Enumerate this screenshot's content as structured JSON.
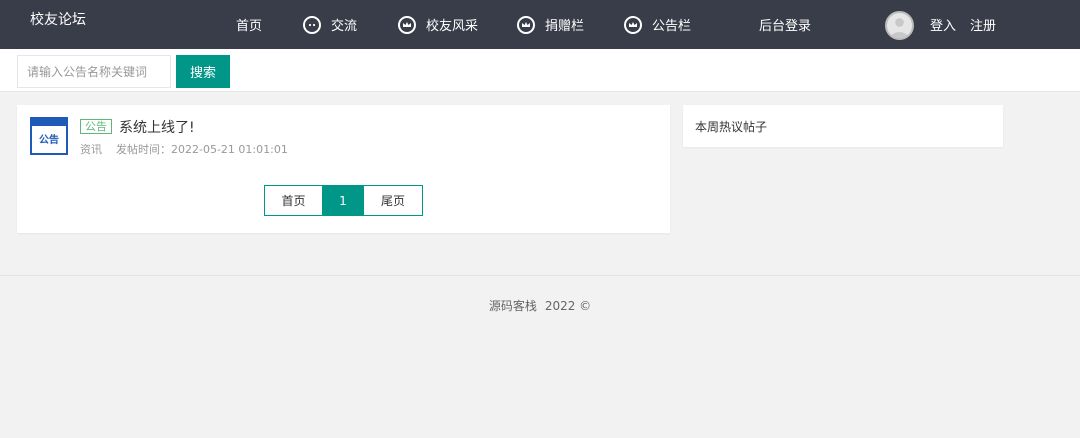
{
  "header": {
    "brand": "校友论坛",
    "nav": [
      {
        "label": "首页",
        "icon": ""
      },
      {
        "label": "交流",
        "icon": "chat-icon"
      },
      {
        "label": "校友风采",
        "icon": "crown-icon"
      },
      {
        "label": "捐赠栏",
        "icon": "crown-icon"
      },
      {
        "label": "公告栏",
        "icon": "crown-icon"
      },
      {
        "label": "后台登录",
        "icon": ""
      }
    ],
    "avatar_icon": "user-avatar-icon",
    "login": "登入",
    "register": "注册"
  },
  "search": {
    "placeholder": "请输入公告名称关键词",
    "value": "",
    "button": "搜索"
  },
  "posts": [
    {
      "thumb_text": "公告",
      "tag": "公告",
      "title": "系统上线了!",
      "category": "资讯",
      "time": "发帖时间：2022-05-21 01:01:01"
    }
  ],
  "pagination": {
    "first": "首页",
    "current": "1",
    "last": "尾页"
  },
  "sidebar": {
    "title": "本周热议帖子"
  },
  "footer": {
    "text": "源码客栈",
    "copyright": "2022 ©"
  },
  "colors": {
    "nav_bg": "#393d49",
    "accent": "#009688",
    "tag": "#5fb878"
  }
}
